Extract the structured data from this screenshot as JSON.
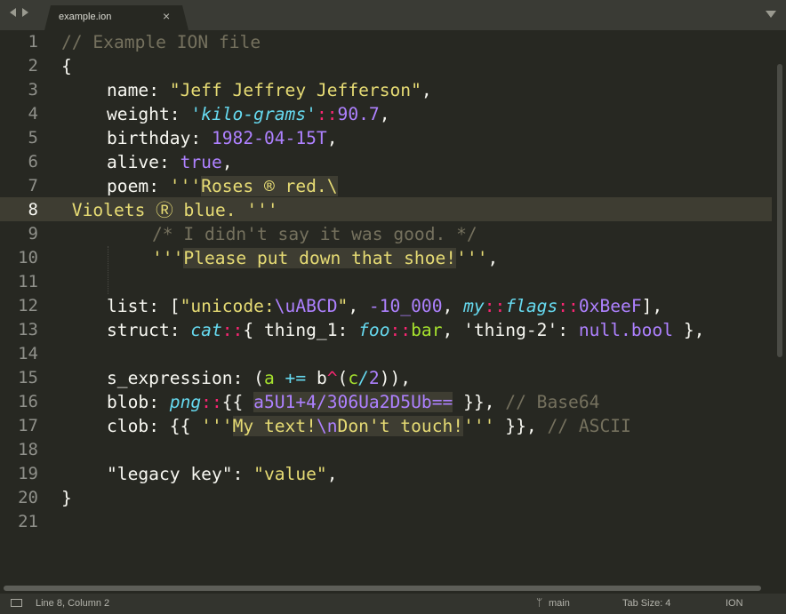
{
  "tab": {
    "title": "example.ion",
    "close_glyph": "×"
  },
  "gutter": {
    "line_numbers": [
      "1",
      "2",
      "3",
      "4",
      "5",
      "6",
      "7",
      "8",
      "9",
      "10",
      "11",
      "12",
      "13",
      "14",
      "15",
      "16",
      "17",
      "18",
      "19",
      "20",
      "21"
    ],
    "current_line": "8"
  },
  "code": {
    "l1": {
      "comment": "// Example ION file"
    },
    "l2": {
      "brace": "{"
    },
    "l3": {
      "key": "name",
      "colon": ": ",
      "value": "\"Jeff Jeffrey Jefferson\"",
      "comma": ","
    },
    "l4": {
      "key": "weight",
      "colon": ": ",
      "annotation": "'kilo-grams'",
      "sep": "::",
      "value": "90.7",
      "comma": ","
    },
    "l5": {
      "key": "birthday",
      "colon": ": ",
      "value": "1982-04-15T",
      "comma": ","
    },
    "l6": {
      "key": "alive",
      "colon": ": ",
      "value": "true",
      "comma": ","
    },
    "l7": {
      "key": "poem",
      "colon": ": ",
      "quote_open": "'''",
      "text": "Roses ® red.\\"
    },
    "l8": {
      "text": " Violets Ⓡ blue. ",
      "quote_close": "'''"
    },
    "l9": {
      "comment": "/* I didn't say it was good. */"
    },
    "l10": {
      "quote_open": "'''",
      "text": "Please put down that shoe!",
      "quote_close": "'''",
      "comma": ","
    },
    "l12": {
      "key": "list",
      "colon": ": ",
      "bracket_open": "[",
      "str_open": "\"unicode:",
      "escape": "\\uABCD",
      "str_close": "\"",
      "comma1": ", ",
      "num1": "-10_000",
      "comma2": ", ",
      "ann1": "my",
      "sep1": "::",
      "ann2": "flags",
      "sep2": "::",
      "num2": "0xBeeF",
      "bracket_close": "],"
    },
    "l13": {
      "key": "struct",
      "colon": ": ",
      "ann": "cat",
      "sep": "::",
      "open": "{ ",
      "k1": "thing_1",
      "c1": ": ",
      "ann2": "foo",
      "sep2": "::",
      "v1": "bar",
      "comma": ", ",
      "k2": "'thing-2'",
      "c2": ": ",
      "v2": "null.bool",
      "close": " },"
    },
    "l15": {
      "key": "s_expression",
      "colon": ": ",
      "open": "(",
      "sym_a": "a",
      "op1": " += ",
      "sym_b": "b",
      "op2": "^",
      "paren_open": "(",
      "sym_c": "c",
      "op3": "/",
      "num": "2",
      "close": ")),"
    },
    "l16": {
      "key": "blob",
      "colon": ": ",
      "ann": "png",
      "sep": "::",
      "open": "{{ ",
      "data": "a5U1+4/306Ua2D5Ub==",
      "close": " }},",
      "comment": " // Base64"
    },
    "l17": {
      "key": "clob",
      "colon": ": ",
      "open": "{{ ",
      "quote_open": "'''",
      "text1": "My text!",
      "escape": "\\n",
      "text2": "Don't touch!",
      "quote_close": "'''",
      "close": " }},",
      "comment": " // ASCII"
    },
    "l19": {
      "key": "\"legacy key\"",
      "colon": ": ",
      "value": "\"value\"",
      "comma": ","
    },
    "l20": {
      "brace": "}"
    }
  },
  "status": {
    "position": "Line 8, Column 2",
    "branch": "main",
    "tab_size": "Tab Size: 4",
    "syntax": "ION",
    "branch_glyph": "ᛘ"
  }
}
